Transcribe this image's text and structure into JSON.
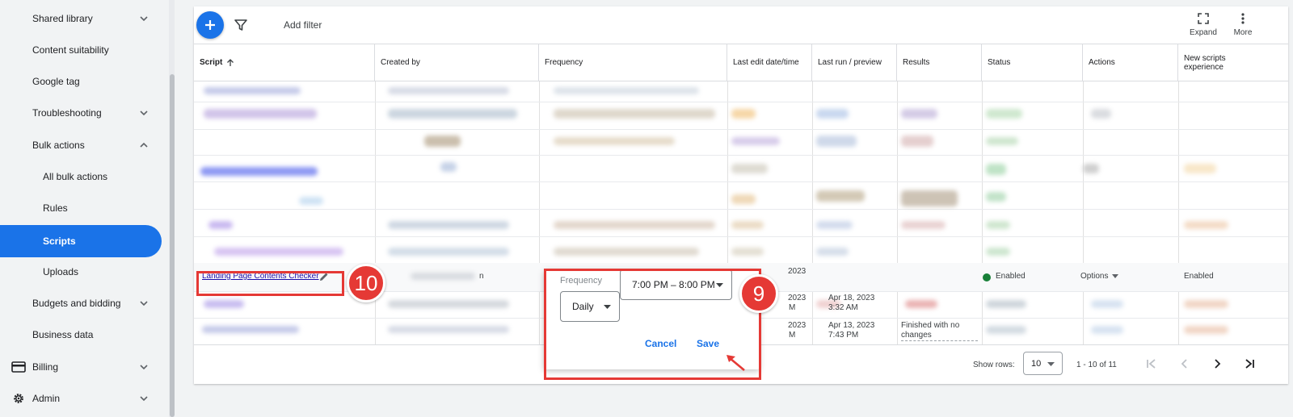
{
  "sidebar": {
    "items": [
      {
        "label": "Shared library",
        "chevron": "down"
      },
      {
        "label": "Content suitability"
      },
      {
        "label": "Google tag"
      },
      {
        "label": "Troubleshooting",
        "chevron": "down"
      },
      {
        "label": "Bulk actions",
        "chevron": "up"
      },
      {
        "label": "All bulk actions"
      },
      {
        "label": "Rules"
      },
      {
        "label": "Scripts",
        "active": true
      },
      {
        "label": "Uploads"
      },
      {
        "label": "Budgets and bidding",
        "chevron": "down"
      },
      {
        "label": "Business data"
      },
      {
        "label": "Billing",
        "chevron": "down",
        "icon": "credit-card-icon"
      },
      {
        "label": "Admin",
        "chevron": "down",
        "icon": "settings-gear-icon"
      }
    ]
  },
  "toolbar": {
    "add_filter": "Add filter",
    "expand": "Expand",
    "more": "More"
  },
  "table": {
    "columns": [
      "Script",
      "Created by",
      "Frequency",
      "Last edit date/time",
      "Last run / preview",
      "Results",
      "Status",
      "Actions",
      "New scripts experience"
    ],
    "sorted_column": "Script",
    "sort_direction": "ascending",
    "highlighted_row": {
      "script": "Landing Page Contents Checker",
      "created_by_suffix": "n",
      "last_edit_fragment": "2023",
      "status": "Enabled",
      "actions": "Options",
      "new_experience": "Enabled"
    },
    "partial_rows": [
      {
        "last_edit": "2023",
        "last_edit_time": "M",
        "last_run": "Apr 18, 2023",
        "last_run_time": "3:32 AM"
      },
      {
        "last_edit": "2023",
        "last_edit_time": "M",
        "last_run": "Apr 13, 2023",
        "last_run_time": "7:43 PM",
        "results": "Finished with no changes"
      }
    ]
  },
  "frequency_popover": {
    "label": "Frequency",
    "period": "Daily",
    "time": "7:00 PM – 8:00 PM",
    "cancel": "Cancel",
    "save": "Save"
  },
  "footer": {
    "show_rows_label": "Show rows:",
    "rows_value": "10",
    "range": "1 - 10 of 11"
  },
  "annotations": {
    "step_edit": "10",
    "step_save": "9"
  },
  "colors": {
    "accent": "#1a73e8",
    "annotation": "#e53935",
    "enabled": "#188038"
  }
}
